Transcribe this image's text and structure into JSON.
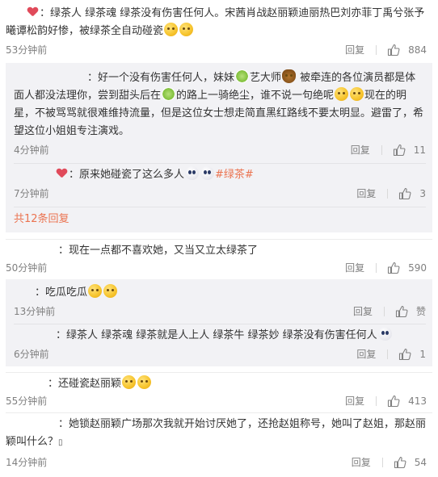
{
  "labels": {
    "reply": "回复",
    "heart_icon_name": "heart-icon",
    "like_icon_name": "thumbs-up-icon"
  },
  "comments": [
    {
      "user": "  ",
      "text_a": "：绿茶人 绿茶魂 绿茶没有伤害任何人。宋茜肖战赵丽颖迪丽热巴刘亦菲丁禹兮张予曦谭松韵好惨，被绿茶全自动碰瓷",
      "time": "53分钟前",
      "likes": "884"
    }
  ],
  "replies_1": [
    {
      "user": "       ",
      "text_a": "：好一个没有伤害任何人，妹妹",
      "text_b": "艺大师",
      "text_c": "被牵连的各位演员都是体面人都没法理你，尝到甜头后在",
      "text_d": "的路上一骑绝尘，谁不说一句绝呢",
      "text_e": "现在的明星，不被骂骂就很难维持流量，但是这位女士想走简直黑红路线不要太明显。避雷了，希望这位小姐姐专注演戏。",
      "time": "4分钟前",
      "likes": "11"
    },
    {
      "user": "    ",
      "text_a": "：原来她碰瓷了这么多人",
      "topic": "#绿茶#",
      "time": "7分钟前",
      "likes": "3"
    }
  ],
  "more_replies": "共12条回复",
  "comment_2": {
    "user": "     ",
    "text_a": "：现在一点都不喜欢她，又当又立太绿茶了",
    "time": "50分钟前",
    "likes": "590"
  },
  "replies_2": [
    {
      "user": "  ",
      "text_a": "：吃瓜吃瓜",
      "time": "13分钟前",
      "likes": "赞"
    },
    {
      "user": "    ",
      "text_a": "：绿茶人 绿茶魂 绿茶就是人上人 绿茶牛 绿茶妙 绿茶没有伤害任何人",
      "time": "6分钟前",
      "likes": "1"
    }
  ],
  "comment_3": {
    "user": "    ",
    "text_a": "：还碰瓷赵丽颖",
    "time": "55分钟前",
    "likes": "413"
  },
  "comment_4": {
    "user": "     ",
    "text_a": "：她锁赵丽颖广场那次我就开始讨厌她了，还抢赵姐称号，她叫了赵姐，那赵丽颖叫什么？",
    "text_b": "▯",
    "time": "14分钟前",
    "likes": "54"
  }
}
